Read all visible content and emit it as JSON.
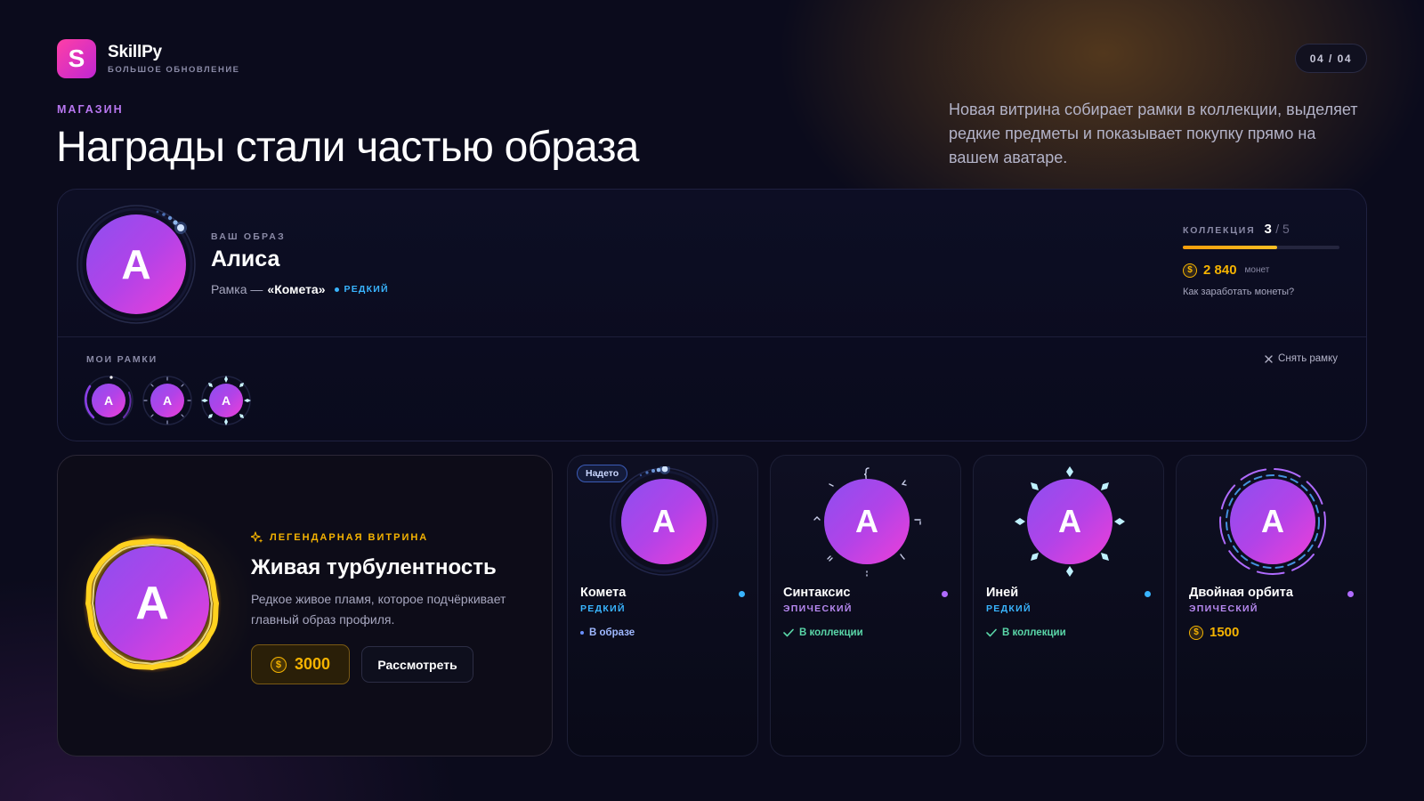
{
  "brand": {
    "name": "SkillPy",
    "subtitle": "БОЛЬШОЕ ОБНОВЛЕНИЕ",
    "logo_letter": "S",
    "logo_gradient": [
      "#ff3fa6",
      "#c026d3"
    ]
  },
  "page_counter": "04 / 04",
  "section_label": "МАГАЗИН",
  "headline": "Награды стали частью образа",
  "lead": "Новая витрина собирает рамки в коллекции, выделяет редкие предметы и показывает покупку прямо на вашем аватаре.",
  "profile": {
    "eyebrow": "ВАШ ОБРАЗ",
    "avatar_letter": "A",
    "name": "Алиса",
    "frame_prefix": "Рамка —",
    "frame_name": "«Комета»",
    "frame_rarity": "РЕДКИЙ",
    "collection": {
      "label": "КОЛЛЕКЦИЯ",
      "count": "3",
      "total": "/ 5",
      "progress": 0.6
    },
    "coins": {
      "amount": "2 840",
      "unit": "монет",
      "icon": "coin-icon"
    },
    "earn_link": "Как заработать монеты?",
    "frames_label": "МОИ РАМКИ",
    "remove_frame": "Снять рамку",
    "mini_frames": [
      {
        "name": "comet",
        "letter": "A"
      },
      {
        "name": "syntax",
        "letter": "A"
      },
      {
        "name": "frost",
        "letter": "A"
      }
    ]
  },
  "legendary": {
    "tag": "ЛЕГЕНДАРНАЯ ВИТРИНА",
    "tag_icon": "sparkle-icon",
    "title": "Живая турбулентность",
    "description": "Редкое живое пламя, которое подчёркивает главный образ профиля.",
    "avatar_letter": "A",
    "price": "3000",
    "view_label": "Рассмотреть"
  },
  "items": [
    {
      "name": "Комета",
      "rarity": "РЕДКИЙ",
      "rarity_class": "rare",
      "badge": "Надето",
      "status": "В образе",
      "status_type": "worn",
      "letter": "A"
    },
    {
      "name": "Синтаксис",
      "rarity": "ЭПИЧЕСКИЙ",
      "rarity_class": "epic",
      "status": "В коллекции",
      "status_type": "owned",
      "letter": "A"
    },
    {
      "name": "Иней",
      "rarity": "РЕДКИЙ",
      "rarity_class": "rare",
      "status": "В коллекции",
      "status_type": "owned",
      "letter": "A"
    },
    {
      "name": "Двойная орбита",
      "rarity": "ЭПИЧЕСКИЙ",
      "rarity_class": "epic",
      "price": "1500",
      "letter": "A"
    }
  ],
  "colors": {
    "accent_purple": "#b877f0",
    "rare": "#39b4ff",
    "epic": "#b06bff",
    "gold": "#f5b301",
    "owned": "#5ad6a8"
  }
}
